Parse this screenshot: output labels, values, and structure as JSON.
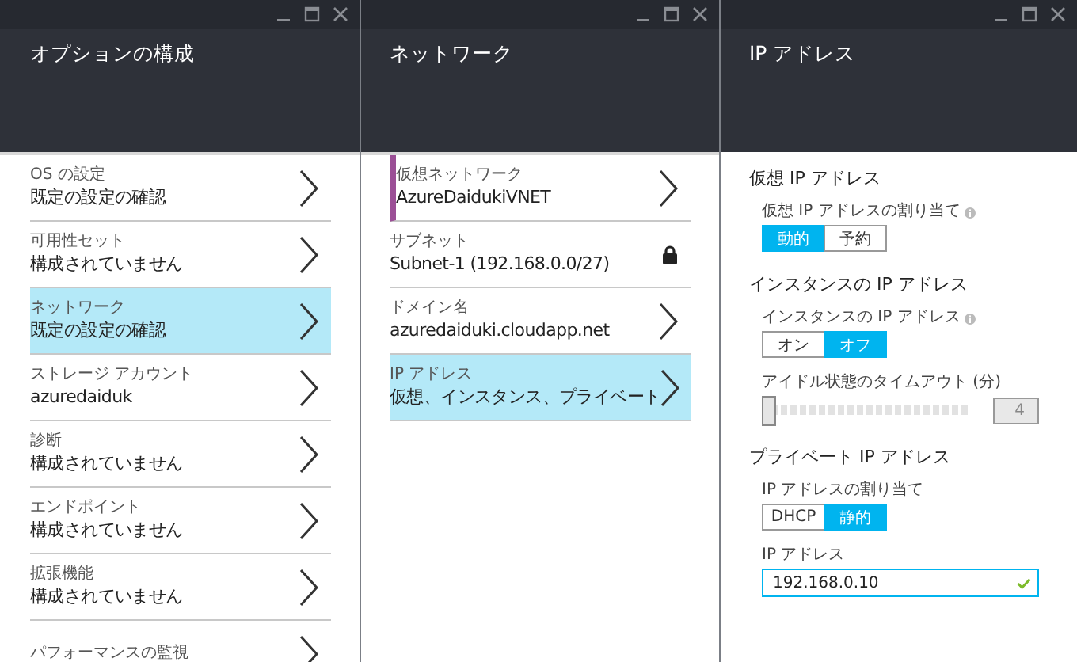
{
  "blades": [
    {
      "kind": "list",
      "title": "オプションの構成",
      "items": [
        {
          "label": "OS の設定",
          "value": "既定の設定の確認",
          "selected": false,
          "accent": false,
          "kind": "chevron"
        },
        {
          "label": "可用性セット",
          "value": "構成されていません",
          "selected": false,
          "accent": false,
          "kind": "chevron"
        },
        {
          "label": "ネットワーク",
          "value": "既定の設定の確認",
          "selected": true,
          "accent": false,
          "kind": "chevron"
        },
        {
          "label": "ストレージ アカウント",
          "value": "azuredaiduk",
          "selected": false,
          "accent": false,
          "kind": "chevron"
        },
        {
          "label": "診断",
          "value": "構成されていません",
          "selected": false,
          "accent": false,
          "kind": "chevron"
        },
        {
          "label": "エンドポイント",
          "value": "構成されていません",
          "selected": false,
          "accent": false,
          "kind": "chevron"
        },
        {
          "label": "拡張機能",
          "value": "構成されていません",
          "selected": false,
          "accent": false,
          "kind": "chevron"
        },
        {
          "label": "パフォーマンスの監視",
          "selected": false,
          "accent": false,
          "kind": "chevron"
        }
      ]
    },
    {
      "kind": "list",
      "title": "ネットワーク",
      "items": [
        {
          "label": "仮想ネットワーク",
          "value": "AzureDaidukiVNET",
          "selected": false,
          "accent": true,
          "kind": "chevron"
        },
        {
          "label": "サブネット",
          "value": "Subnet-1 (192.168.0.0/27)",
          "selected": false,
          "accent": false,
          "kind": "lock"
        },
        {
          "label": "ドメイン名",
          "value": "azuredaiduki.cloudapp.net",
          "selected": false,
          "accent": false,
          "kind": "chevron"
        },
        {
          "label": "IP アドレス",
          "value": "仮想、インスタンス、プライベート",
          "selected": true,
          "accent": false,
          "kind": "chevron"
        }
      ]
    },
    {
      "kind": "form",
      "title": "IP アドレス",
      "sections": [
        {
          "heading": "仮想 IP アドレス",
          "fields": [
            {
              "kind": "toggle",
              "label": "仮想 IP アドレスの割り当て",
              "info": true,
              "options": [
                {
                  "label": "動的",
                  "selected": true
                },
                {
                  "label": "予約",
                  "selected": false
                }
              ]
            }
          ]
        },
        {
          "heading": "インスタンスの IP アドレス",
          "fields": [
            {
              "kind": "toggle",
              "label": "インスタンスの IP アドレス",
              "info": true,
              "options": [
                {
                  "label": "オン",
                  "selected": false
                },
                {
                  "label": "オフ",
                  "selected": true
                }
              ]
            },
            {
              "kind": "slider",
              "label": "アイドル状態のタイムアウト (分)",
              "level": 0,
              "value": "4"
            }
          ]
        },
        {
          "heading": "プライベート IP アドレス",
          "fields": [
            {
              "kind": "toggle",
              "label": "IP アドレスの割り当て",
              "info": false,
              "options": [
                {
                  "label": "DHCP",
                  "selected": false
                },
                {
                  "label": "静的",
                  "selected": true
                }
              ]
            },
            {
              "kind": "text",
              "label": "IP アドレス",
              "value": "192.168.0.10",
              "valid": true
            }
          ]
        }
      ]
    }
  ]
}
